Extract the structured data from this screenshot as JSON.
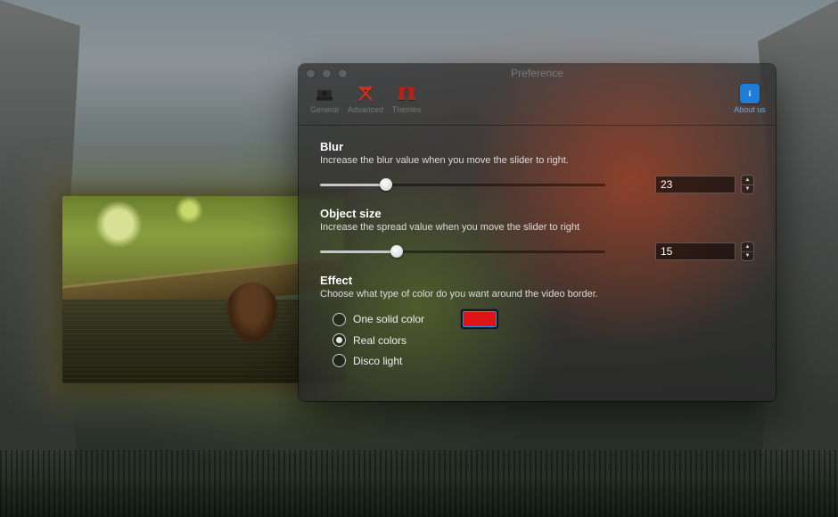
{
  "window": {
    "title": "Preference",
    "tabs": {
      "general": "General",
      "advanced": "Advanced",
      "themes": "Themes"
    },
    "about_label": "About us",
    "about_glyph": "i"
  },
  "blur": {
    "title": "Blur",
    "desc": "Increase the blur value when you move the slider to right.",
    "value": "23",
    "percent": 23
  },
  "object_size": {
    "title": "Object size",
    "desc": "Increase the spread value when you move the slider to right",
    "value": "15",
    "percent": 27
  },
  "effect": {
    "title": "Effect",
    "desc": "Choose what type of color do you want around the video border.",
    "options": {
      "one_solid": "One solid color",
      "real_colors": "Real colors",
      "disco": "Disco light"
    },
    "selected": "real_colors",
    "solid_color": "#e01414"
  }
}
